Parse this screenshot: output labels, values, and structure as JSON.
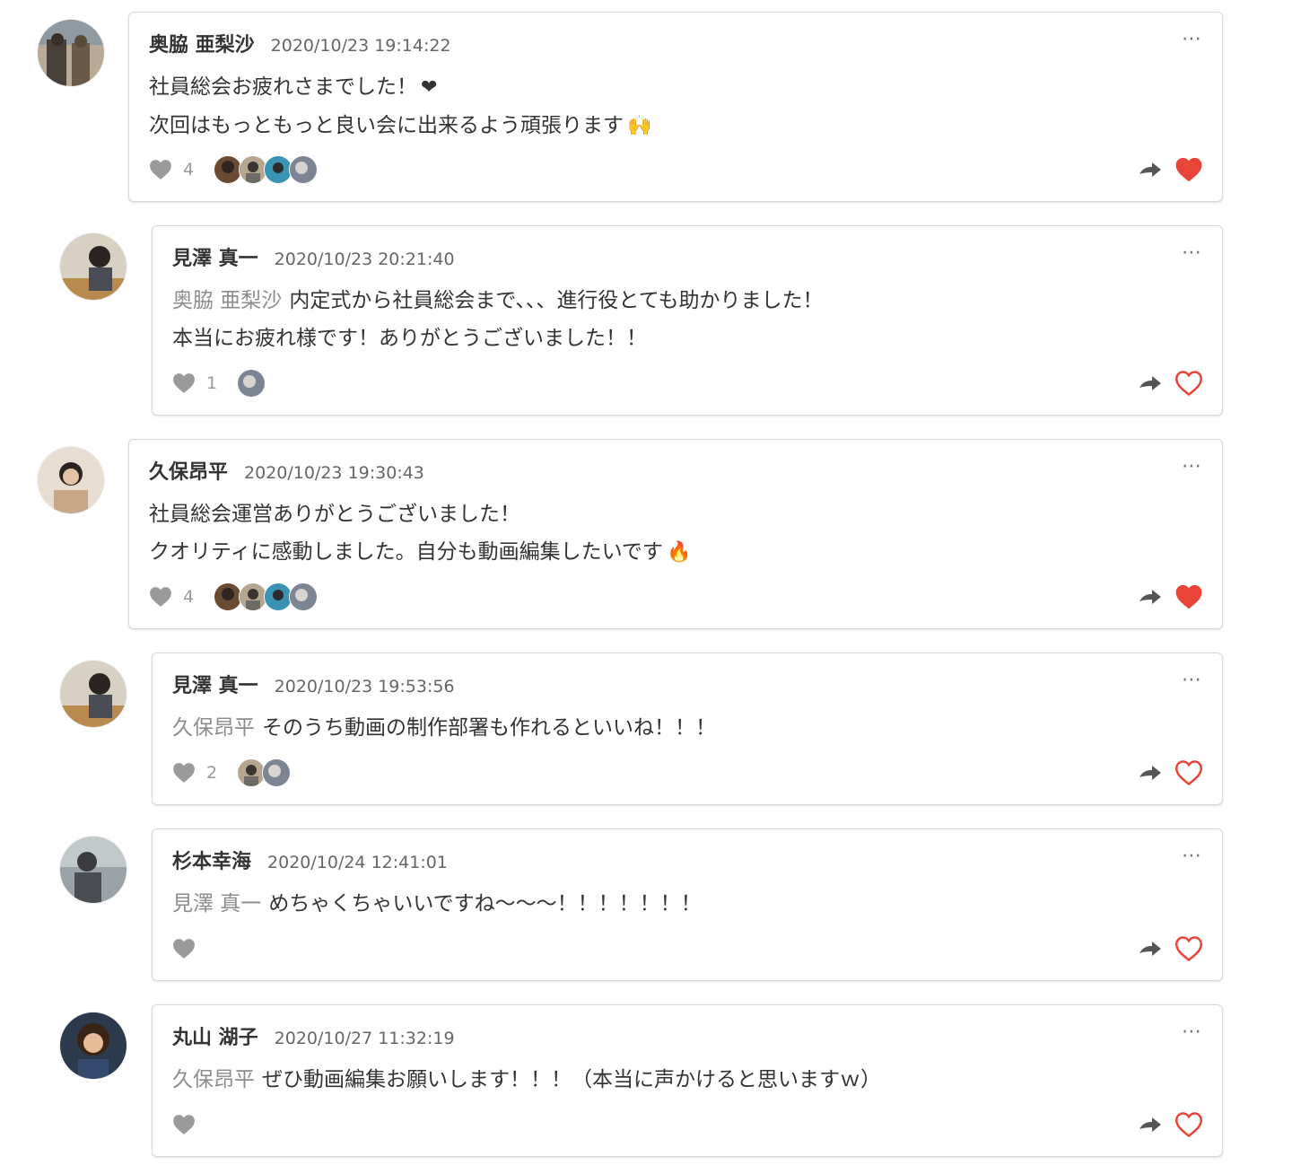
{
  "colors": {
    "heart_active": "#e9443a",
    "heart_outline": "#e9443a",
    "like_gray": "#9a9a9a",
    "mention_gray": "#8c8c8c",
    "card_border": "#d9d9d9"
  },
  "comments": [
    {
      "author": "奥脇 亜梨沙",
      "time": "2020/10/23 19:14:22",
      "mention": "",
      "line1": "社員総会お疲れさまでした！",
      "line1_emoji": "❤",
      "line2": "次回はもっともっと良い会に出来るよう頑張ります",
      "line2_emoji": "🙌",
      "like_count": "4",
      "liked": true,
      "menu": "⋯"
    },
    {
      "author": "見澤 真一",
      "time": "2020/10/23 20:21:40",
      "mention": "奥脇 亜梨沙",
      "line1": "内定式から社員総会まで、、、進行役とても助かりました！",
      "line1_emoji": "",
      "line2": "本当にお疲れ様です！ありがとうございました！！",
      "line2_emoji": "",
      "like_count": "1",
      "liked": false,
      "menu": "⋯"
    },
    {
      "author": "久保昂平",
      "time": "2020/10/23 19:30:43",
      "mention": "",
      "line1": "社員総会運営ありがとうございました！",
      "line1_emoji": "",
      "line2": "クオリティに感動しました。自分も動画編集したいです",
      "line2_emoji": "🔥",
      "like_count": "4",
      "liked": true,
      "menu": "⋯"
    },
    {
      "author": "見澤 真一",
      "time": "2020/10/23 19:53:56",
      "mention": "久保昂平",
      "line1": "そのうち動画の制作部署も作れるといいね！！！",
      "line1_emoji": "",
      "line2": "",
      "line2_emoji": "",
      "like_count": "2",
      "liked": false,
      "menu": "⋯"
    },
    {
      "author": "杉本幸海",
      "time": "2020/10/24 12:41:01",
      "mention": "見澤 真一",
      "line1": "めちゃくちゃいいですね〜〜〜！！！！！！！",
      "line1_emoji": "",
      "line2": "",
      "line2_emoji": "",
      "like_count": "",
      "liked": false,
      "menu": "⋯"
    },
    {
      "author": "丸山 湖子",
      "time": "2020/10/27 11:32:19",
      "mention": "久保昂平",
      "line1": "ぜひ動画編集お願いします！！！（本当に声かけると思いますｗ）",
      "line1_emoji": "",
      "line2": "",
      "line2_emoji": "",
      "like_count": "",
      "liked": false,
      "menu": "⋯"
    }
  ]
}
